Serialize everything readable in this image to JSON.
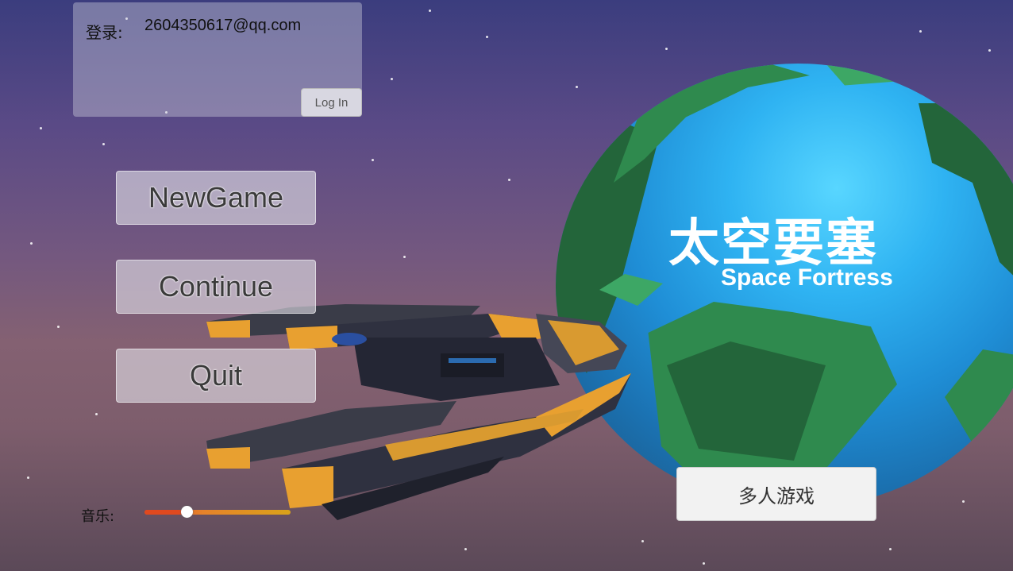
{
  "login": {
    "label": "登录:",
    "email": "2604350617@qq.com",
    "button_label": "Log In"
  },
  "menu": {
    "new_game": "NewGame",
    "continue": "Continue",
    "quit": "Quit"
  },
  "title": {
    "chinese": "太空要塞",
    "english": "Space Fortress"
  },
  "multiplayer_label": "多人游戏",
  "music": {
    "label": "音乐:",
    "volume_fraction": 0.29
  },
  "colors": {
    "slider_start": "#e0491f",
    "slider_end": "#d9a21a",
    "ship_accent": "#e8a030",
    "ship_hull": "#3a3c48"
  }
}
